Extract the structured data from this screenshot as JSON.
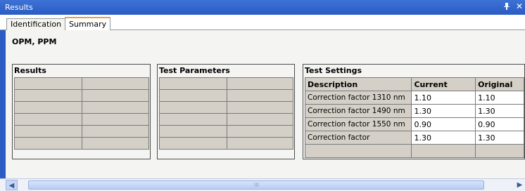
{
  "window": {
    "title": "Results",
    "pin_glyph": "p",
    "close_glyph": "×"
  },
  "tabs": [
    {
      "label": "Identification",
      "active": false
    },
    {
      "label": "Summary",
      "active": true
    }
  ],
  "page_heading": "OPM, PPM",
  "results_panel": {
    "title": "Results"
  },
  "test_parameters_panel": {
    "title": "Test Parameters"
  },
  "test_settings_panel": {
    "title": "Test Settings",
    "columns": [
      "Description",
      "Current",
      "Original"
    ],
    "rows": [
      [
        "Correction factor 1310 nm",
        "1.10",
        "1.10"
      ],
      [
        "Correction factor 1490 nm",
        "1.30",
        "1.30"
      ],
      [
        "Correction factor 1550 nm",
        "0.90",
        "0.90"
      ],
      [
        "Correction factor",
        "1.30",
        "1.30"
      ]
    ]
  },
  "scrollbar": {
    "left_arrow": "<",
    "right_arrow": ">",
    "grip": "III"
  },
  "colors": {
    "title_bar": "#2a5cc4",
    "active_tab_accent": "#e8a33d",
    "grid_cell": "#d4d0c8"
  }
}
